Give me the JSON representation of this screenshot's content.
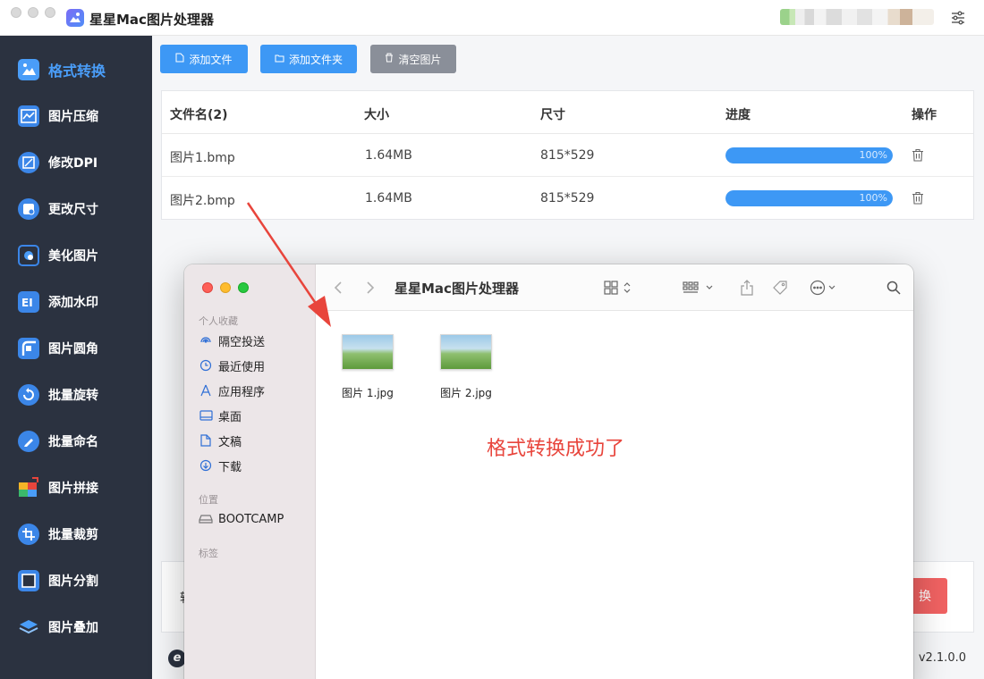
{
  "app": {
    "title": "星星Mac图片处理器",
    "version": "v2.1.0.0",
    "footer_logo": "e",
    "footer_separator": ":"
  },
  "sidebar": {
    "items": [
      {
        "label": "格式转换",
        "icon": "format-convert-icon",
        "active": true
      },
      {
        "label": "图片压缩",
        "icon": "compress-icon"
      },
      {
        "label": "修改DPI",
        "icon": "dpi-icon"
      },
      {
        "label": "更改尺寸",
        "icon": "resize-icon"
      },
      {
        "label": "美化图片",
        "icon": "beautify-icon"
      },
      {
        "label": "添加水印",
        "icon": "watermark-icon"
      },
      {
        "label": "图片圆角",
        "icon": "round-corner-icon"
      },
      {
        "label": "批量旋转",
        "icon": "rotate-icon"
      },
      {
        "label": "批量命名",
        "icon": "rename-icon"
      },
      {
        "label": "图片拼接",
        "icon": "stitch-icon"
      },
      {
        "label": "批量裁剪",
        "icon": "crop-icon"
      },
      {
        "label": "图片分割",
        "icon": "split-icon"
      },
      {
        "label": "图片叠加",
        "icon": "overlay-icon"
      }
    ]
  },
  "toolbar": {
    "add_file": "添加文件",
    "add_folder": "添加文件夹",
    "clear": "清空图片"
  },
  "table": {
    "headers": {
      "name": "文件名(2)",
      "size": "大小",
      "dimensions": "尺寸",
      "progress": "进度",
      "actions": "操作"
    },
    "rows": [
      {
        "name": "图片1.bmp",
        "size": "1.64MB",
        "dimensions": "815*529",
        "progress": 1.0,
        "progress_label": "100%"
      },
      {
        "name": "图片2.bmp",
        "size": "1.64MB",
        "dimensions": "815*529",
        "progress": 1.0,
        "progress_label": "100%"
      }
    ]
  },
  "bottom": {
    "left_text_partial": "转",
    "start_button_partial": "换"
  },
  "finder": {
    "title": "星星Mac图片处理器",
    "sections": {
      "favorites": "个人收藏",
      "locations": "位置",
      "tags": "标签"
    },
    "favorites": [
      {
        "label": "隔空投送",
        "icon": "airdrop-icon"
      },
      {
        "label": "最近使用",
        "icon": "recents-icon"
      },
      {
        "label": "应用程序",
        "icon": "applications-icon"
      },
      {
        "label": "桌面",
        "icon": "desktop-icon"
      },
      {
        "label": "文稿",
        "icon": "documents-icon"
      },
      {
        "label": "下载",
        "icon": "downloads-icon"
      }
    ],
    "locations": [
      {
        "label": "BOOTCAMP",
        "icon": "drive-icon"
      }
    ],
    "files": [
      {
        "name": "图片 1.jpg"
      },
      {
        "name": "图片 2.jpg"
      }
    ]
  },
  "annotation": {
    "success_text": "格式转换成功了",
    "color": "#e8453c"
  },
  "colors": {
    "accent": "#3d98f5",
    "sidebar_bg": "#2b3240",
    "danger": "#f06262"
  }
}
